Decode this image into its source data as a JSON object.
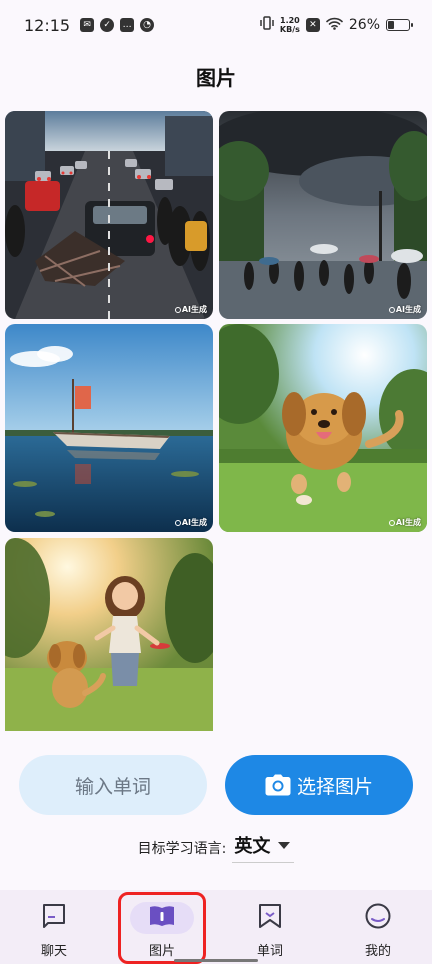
{
  "status_bar": {
    "time": "12:15",
    "speed_value": "1.20",
    "speed_unit": "KB/s",
    "battery_percent": "26%"
  },
  "page": {
    "title": "图片"
  },
  "gallery": {
    "badge_text": "AI生成",
    "photos": [
      {
        "subject": "traffic-jam-car-wreck"
      },
      {
        "subject": "storm-crowd-umbrellas"
      },
      {
        "subject": "boat-on-lake"
      },
      {
        "subject": "golden-retriever-running"
      },
      {
        "subject": "girl-with-dog-frisbee"
      }
    ]
  },
  "actions": {
    "input_word_label": "输入单词",
    "select_image_label": "选择图片"
  },
  "language": {
    "label": "目标学习语言:",
    "value": "英文"
  },
  "nav": {
    "items": [
      {
        "label": "聊天",
        "icon": "chat-icon"
      },
      {
        "label": "图片",
        "icon": "image-book-icon",
        "active": true
      },
      {
        "label": "单词",
        "icon": "bookmark-icon"
      },
      {
        "label": "我的",
        "icon": "profile-icon"
      }
    ]
  },
  "colors": {
    "primary": "#1e88e5",
    "secondary_button": "#deeefb",
    "nav_background": "#f3edf7",
    "active_pill": "#e6ddf7",
    "highlight_box": "#ee2222"
  }
}
